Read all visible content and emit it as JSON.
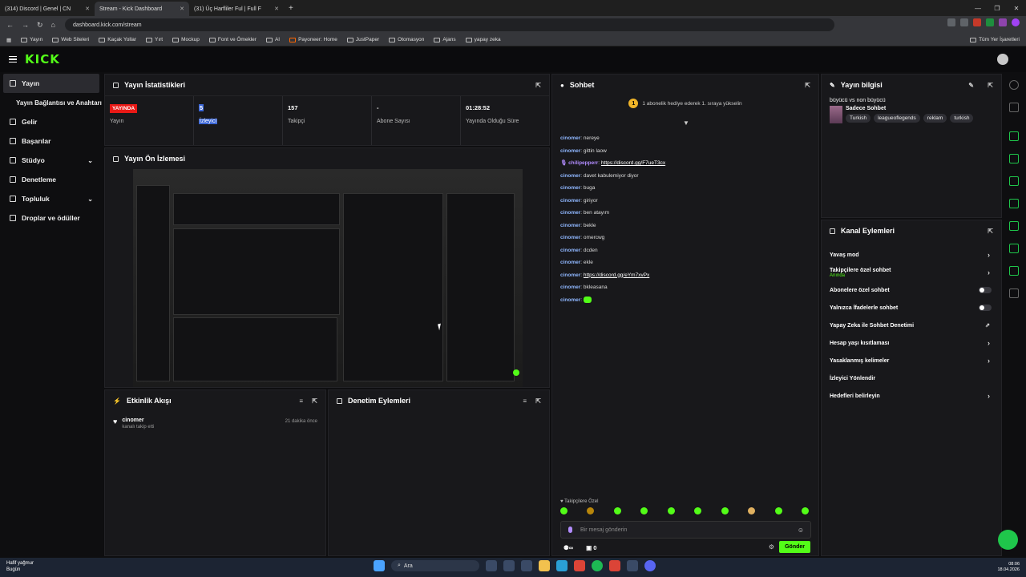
{
  "browser": {
    "tabs": [
      {
        "title": "(314) Discord | Genel | CN"
      },
      {
        "title": "Stream - Kick Dashboard"
      },
      {
        "title": "(31) Üç Harfliler Ful | Full F"
      }
    ],
    "url": "dashboard.kick.com/stream",
    "bookmarks": [
      "Yayın",
      "Web Siteleri",
      "Kaçak Yollar",
      "Yırt",
      "Mockup",
      "Font ve Ömekler",
      "AI",
      "Payoneer: Home",
      "JustPaper",
      "Otomasyon",
      "Ajans",
      "yapay zeka"
    ],
    "other_bookmarks": "Tüm Yer İşaretleri"
  },
  "kick": {
    "logo": "KICK",
    "sidebar": [
      {
        "label": "Yayın"
      },
      {
        "label": "Yayın Bağlantısı ve Anahtarı"
      },
      {
        "label": "Gelir"
      },
      {
        "label": "Başarılar"
      },
      {
        "label": "Stüdyo"
      },
      {
        "label": "Denetleme"
      },
      {
        "label": "Topluluk"
      },
      {
        "label": "Droplar ve ödüller"
      }
    ],
    "stats_panel": {
      "title": "Yayın İstatistikleri",
      "live_badge": "YAYINDA",
      "items": [
        {
          "value": "",
          "label": "Yayın"
        },
        {
          "value": "5",
          "label": "İzleyici"
        },
        {
          "value": "157",
          "label": "Takipçi"
        },
        {
          "value": "-",
          "label": "Abone Sayısı"
        },
        {
          "value": "01:28:52",
          "label": "Yayında Olduğu Süre"
        }
      ]
    },
    "preview_panel": {
      "title": "Yayın Ön İzlemesi"
    },
    "activity_panel": {
      "title": "Etkinlik Akışı",
      "events": [
        {
          "user": "cinomer",
          "desc": "kanalı takip etti",
          "time": "21 dakika önce"
        }
      ]
    },
    "moderation_panel": {
      "title": "Denetim Eylemleri"
    },
    "chat": {
      "title": "Sohbet",
      "notice": "1 abonelik hediye ederek 1. sıraya yükselin",
      "messages": [
        {
          "user": "cinomer",
          "text": "nereye"
        },
        {
          "user": "cinomer",
          "text": "gittin laow"
        },
        {
          "user": "chilipepperr",
          "text": "https://discord.gg/F7ueT3cx"
        },
        {
          "user": "cinomer",
          "text": "davet kabulemiyor diyor"
        },
        {
          "user": "cinomer",
          "text": "buga"
        },
        {
          "user": "cinomer",
          "text": "giriyor"
        },
        {
          "user": "cinomer",
          "text": "ben atayım"
        },
        {
          "user": "cinomer",
          "text": "bekle"
        },
        {
          "user": "cinomer",
          "text": "omercwg"
        },
        {
          "user": "cinomer",
          "text": "dcden"
        },
        {
          "user": "cinomer",
          "text": "ekle"
        },
        {
          "user": "cinomer",
          "text": "https://discord.gg/eYm7xvPx"
        },
        {
          "user": "cinomer",
          "text": "bkleasana"
        },
        {
          "user": "cinomer",
          "text": ""
        }
      ],
      "followers_only": "Takipçilere Özel",
      "input_placeholder": "Bir mesaj gönderin",
      "viewers_count": "0",
      "send_label": "Gönder"
    },
    "info_panel": {
      "title": "Yayın bilgisi",
      "stream_title": "büyücü vs non büyücü",
      "category": "Sadece Sohbet",
      "tags": [
        "Turkish",
        "leagueoflegends",
        "reklam",
        "turkish"
      ]
    },
    "channel_actions": {
      "title": "Kanal Eylemleri",
      "items": [
        {
          "label": "Yavaş mod",
          "sub": "",
          "control": "arrow"
        },
        {
          "label": "Takipçilere özel sohbet",
          "sub": "Anında",
          "control": "arrow"
        },
        {
          "label": "Abonelere özel sohbet",
          "sub": "",
          "control": "toggle"
        },
        {
          "label": "Yalnızca İfadelerle sohbet",
          "sub": "",
          "control": "toggle"
        },
        {
          "label": "Yapay Zeka ile Sohbet Denetimi",
          "sub": "",
          "control": "external"
        },
        {
          "label": "Hesap yaşı kısıtlaması",
          "sub": "",
          "control": "arrow"
        },
        {
          "label": "Yasaklanmış kelimeler",
          "sub": "",
          "control": "arrow"
        },
        {
          "label": "İzleyici Yönlendir",
          "sub": "",
          "control": "none"
        },
        {
          "label": "Hedefleri belirleyin",
          "sub": "",
          "control": "arrow"
        }
      ]
    }
  },
  "taskbar": {
    "weather": "Hafif yağmur",
    "weather_sub": "Bugün",
    "search": "Ara",
    "time": "08:06",
    "date": "18.04.2026"
  }
}
